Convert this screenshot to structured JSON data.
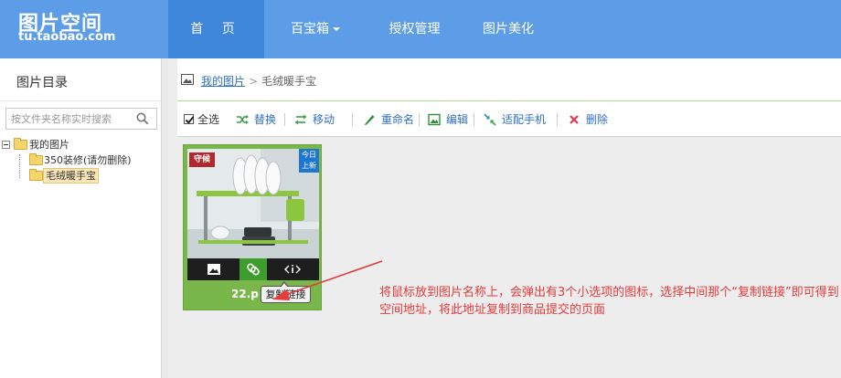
{
  "header": {
    "logo_title": "图片空间",
    "logo_sub": "tu.taobao.com",
    "nav": [
      {
        "label": "首 页",
        "active": true
      },
      {
        "label": "百宝箱",
        "has_dropdown": true
      },
      {
        "label": "授权管理"
      },
      {
        "label": "图片美化"
      }
    ]
  },
  "sidebar": {
    "title": "图片目录",
    "search": {
      "placeholder": "按文件夹名称实时搜索",
      "value": ""
    },
    "tree": {
      "root": "我的图片",
      "children": [
        {
          "label": "350装修(请勿删除)",
          "selected": false
        },
        {
          "label": "毛绒暖手宝",
          "selected": true
        }
      ]
    }
  },
  "breadcrumb": {
    "root": "我的图片",
    "separator": ">",
    "current": "毛绒暖手宝"
  },
  "toolbar": {
    "select_all": "全选",
    "select_all_checked": true,
    "replace": "替换",
    "move": "移动",
    "rename": "重命名",
    "edit": "编辑",
    "mobile": "适配手机",
    "delete": "删除"
  },
  "image_card": {
    "brand_tag": "守候",
    "today_tag": "今日上新",
    "name": "22.p",
    "hover_actions": [
      {
        "icon": "image-icon"
      },
      {
        "icon": "link-icon"
      },
      {
        "icon": "info-icon"
      }
    ],
    "tooltip": "复制链接"
  },
  "annotation": {
    "text": "将鼠标放到图片名称上，会弹出有3个小选项的图标，选择中间那个“复制链接”即可得到空间地址，将此地址复制到商品提交的页面"
  },
  "colors": {
    "header_bg": "#5d9de8",
    "nav_active": "#3d86d9",
    "link": "#2f6fc9",
    "card_green": "#7ab74b",
    "annotation_red": "#e83a3a"
  }
}
